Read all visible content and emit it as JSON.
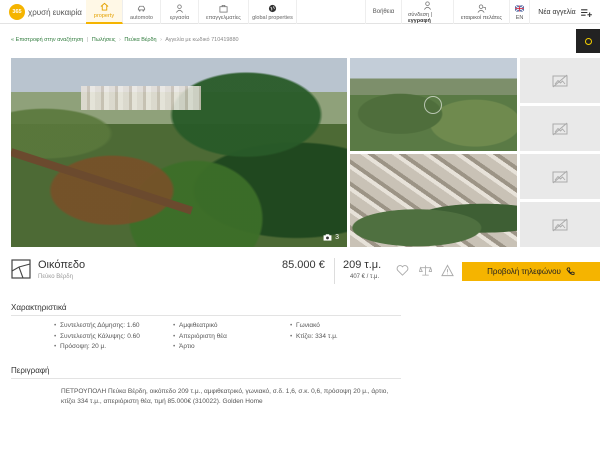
{
  "header": {
    "logo_badge": "365",
    "logo_text": "χρυσή ευκαιρία",
    "nav": [
      {
        "label": "property",
        "icon": "home-icon"
      },
      {
        "label": "automoto",
        "icon": "car-icon"
      },
      {
        "label": "εργασία",
        "icon": "person-icon"
      },
      {
        "label": "επαγγελματίες",
        "icon": "briefcase-icon"
      },
      {
        "label": "global properties",
        "icon": "globe-icon"
      }
    ],
    "help": "Βοήθεια",
    "login": "σύνδεση",
    "register": "εγγραφή",
    "business": "εταιρικοί πελάτες",
    "lang": "EN",
    "new_ad": "Νέα αγγελία"
  },
  "breadcrumb": {
    "back": "Επιστροφή στην αναζήτηση",
    "sales": "Πωλήσεις",
    "area": "Πεύκα Βέρδη",
    "current": "Αγγελία με κωδικό 710419880"
  },
  "gallery": {
    "photo_count": "3"
  },
  "listing": {
    "title": "Οικόπεδο",
    "location": "Πεύκο Βέρδη",
    "price": "85.000 €",
    "area": "209 τ.μ.",
    "price_per_m2": "407 € / τ.μ.",
    "phone_button": "Προβολή τηλεφώνου"
  },
  "features": {
    "title": "Χαρακτηριστικά",
    "col1": [
      "Συντελεστής Δόμησης: 1.60",
      "Συντελεστής Κάλυψης: 0.60",
      "Πρόσοψη: 20 μ."
    ],
    "col2": [
      "Αμφιθεατρικό",
      "Απεριόριστη θέα",
      "Άρτιο"
    ],
    "col3": [
      "Γωνιακό",
      "Κτίζει: 334 τ.μ."
    ]
  },
  "description": {
    "title": "Περιγραφή",
    "text": "ΠΕΤΡΟΥΠΟΛΗ Πεύκα Βέρδη, οικόπεδο 209 τ.μ., αμφιθεατρικό, γωνιακό, σ.δ. 1,6, σ.κ. 0,6, πρόσοψη 20 μ., άρτιο, κτίζει 334 τ.μ., απεριόριστη θέα, τιμή 85.000€ (310022). Golden Home"
  },
  "colors": {
    "accent": "#f5b400",
    "link": "#2f7b3c"
  }
}
